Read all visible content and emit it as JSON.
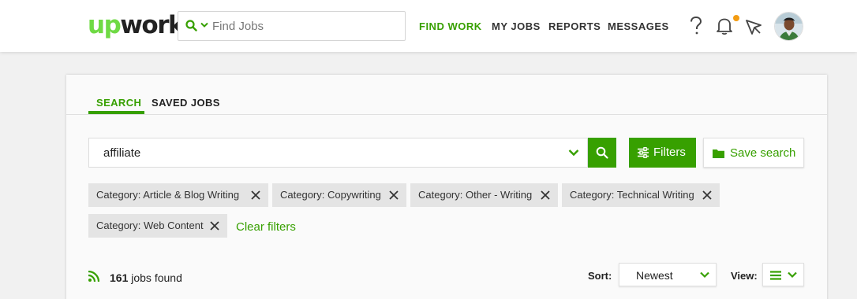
{
  "header": {
    "logo_up": "up",
    "logo_work": "work",
    "search_placeholder": "Find Jobs",
    "nav": [
      "FIND WORK",
      "MY JOBS",
      "REPORTS",
      "MESSAGES"
    ],
    "active_nav": "FIND WORK",
    "icons": [
      "help-icon",
      "bell-icon",
      "send-icon"
    ],
    "notification_dot_color": "#f39c12"
  },
  "tabs": [
    "SEARCH",
    "SAVED JOBS"
  ],
  "search": {
    "query": "affiliate",
    "filters_label": "Filters",
    "save_label": "Save search"
  },
  "chips": [
    "Category: Article & Blog Writing",
    "Category: Copywriting",
    "Category: Other - Writing",
    "Category: Technical Writing",
    "Category: Web Content"
  ],
  "clear_filters": "Clear filters",
  "results": {
    "count": "161",
    "suffix": " jobs found"
  },
  "sort": {
    "label": "Sort:",
    "value": "Newest"
  },
  "view": {
    "label": "View:"
  },
  "colors": {
    "brand_green": "#37a000",
    "logo_green": "#6fda44"
  }
}
